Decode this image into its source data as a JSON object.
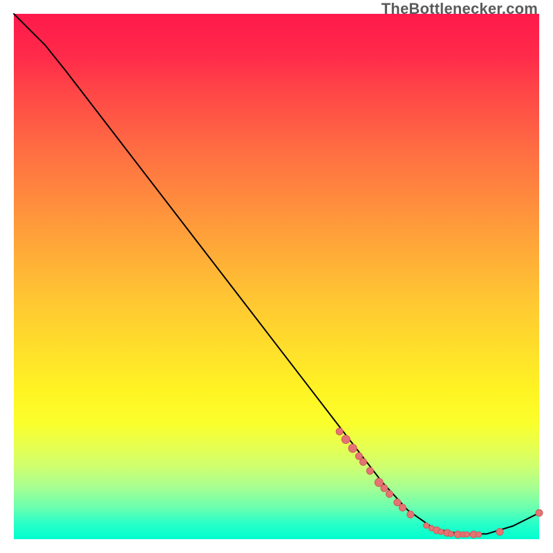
{
  "attribution": "TheBottlenecker.com",
  "colors": {
    "curve": "#000000",
    "dot_fill": "#e57373",
    "dot_stroke": "#cc5a5a"
  },
  "chart_data": {
    "type": "line",
    "title": "",
    "xlabel": "",
    "ylabel": "",
    "xlim": [
      0,
      100
    ],
    "ylim": [
      0,
      100
    ],
    "series": [
      {
        "name": "bottleneck-curve",
        "x": [
          0,
          6,
          10,
          15,
          20,
          25,
          30,
          35,
          40,
          45,
          50,
          55,
          60,
          65,
          70,
          75,
          80,
          85,
          90,
          95,
          100
        ],
        "values": [
          100,
          94,
          89,
          82.5,
          76,
          69.5,
          63,
          56.5,
          50,
          43.5,
          37,
          30.5,
          24,
          17.5,
          11,
          5.5,
          2,
          1,
          1,
          2.5,
          5
        ]
      }
    ],
    "markers": [
      {
        "x": 62.0,
        "y": 20.5,
        "r": 5
      },
      {
        "x": 63.2,
        "y": 19.0,
        "r": 6
      },
      {
        "x": 64.5,
        "y": 17.3,
        "r": 6
      },
      {
        "x": 65.7,
        "y": 15.8,
        "r": 5
      },
      {
        "x": 66.5,
        "y": 14.7,
        "r": 5
      },
      {
        "x": 67.8,
        "y": 13.0,
        "r": 5
      },
      {
        "x": 69.5,
        "y": 10.8,
        "r": 6
      },
      {
        "x": 70.5,
        "y": 9.7,
        "r": 5
      },
      {
        "x": 71.5,
        "y": 8.6,
        "r": 5
      },
      {
        "x": 73.0,
        "y": 7.0,
        "r": 5
      },
      {
        "x": 74.0,
        "y": 6.0,
        "r": 5
      },
      {
        "x": 75.5,
        "y": 4.7,
        "r": 5
      },
      {
        "x": 78.5,
        "y": 2.6,
        "r": 4
      },
      {
        "x": 79.5,
        "y": 2.1,
        "r": 4
      },
      {
        "x": 80.5,
        "y": 1.7,
        "r": 5
      },
      {
        "x": 81.3,
        "y": 1.4,
        "r": 4
      },
      {
        "x": 82.5,
        "y": 1.2,
        "r": 5
      },
      {
        "x": 83.2,
        "y": 1.0,
        "r": 4
      },
      {
        "x": 84.5,
        "y": 0.9,
        "r": 5
      },
      {
        "x": 85.5,
        "y": 0.9,
        "r": 4
      },
      {
        "x": 86.2,
        "y": 0.9,
        "r": 4
      },
      {
        "x": 87.5,
        "y": 0.9,
        "r": 5
      },
      {
        "x": 88.5,
        "y": 0.9,
        "r": 4
      },
      {
        "x": 92.5,
        "y": 1.4,
        "r": 5
      },
      {
        "x": 100.0,
        "y": 5.0,
        "r": 5
      }
    ]
  }
}
